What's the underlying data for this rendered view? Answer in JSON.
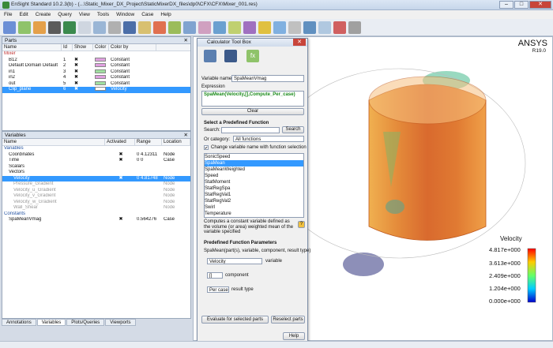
{
  "window": {
    "title": "EnSight Standard 10.2.3(b) - (...\\Static_Mixer_DX_Project\\StaticMixerDX_files\\dp0\\CFX\\CFX\\Mixer_001.res)"
  },
  "menu": [
    "File",
    "Edit",
    "Create",
    "Query",
    "View",
    "Tools",
    "Window",
    "Case",
    "Help"
  ],
  "parts": {
    "title": "Parts",
    "headers": [
      "Name",
      "Id",
      "Show",
      "Color",
      "Color by"
    ],
    "rows": [
      {
        "name": "Mixer",
        "id": "",
        "color": "",
        "colorby": ""
      },
      {
        "name": "B12",
        "id": "1",
        "color": "#e0a0e0",
        "colorby": "Constant"
      },
      {
        "name": "Default Domain Default",
        "id": "2",
        "color": "#e0a0e0",
        "colorby": "Constant"
      },
      {
        "name": "in1",
        "id": "3",
        "color": "#a0e0a0",
        "colorby": "Constant"
      },
      {
        "name": "in2",
        "id": "4",
        "color": "#e0a0e0",
        "colorby": "Constant"
      },
      {
        "name": "out",
        "id": "5",
        "color": "#a0e0a0",
        "colorby": "Constant"
      },
      {
        "name": "Clip_plane",
        "id": "6",
        "color": "#ffffff",
        "colorby": "Velocity"
      }
    ]
  },
  "variables": {
    "title": "Variables",
    "headers": [
      "Name",
      "Activated",
      "Range",
      "Location"
    ],
    "rows": [
      {
        "name": "Variables",
        "act": "",
        "range": "",
        "loc": ""
      },
      {
        "name": "Coordinates",
        "act": "✖",
        "range": "0  4.12311",
        "loc": "Node"
      },
      {
        "name": "Time",
        "act": "✖",
        "range": "0  0",
        "loc": "Case"
      },
      {
        "name": "Scalars",
        "act": "",
        "range": "",
        "loc": ""
      },
      {
        "name": "Vectors",
        "act": "",
        "range": "",
        "loc": ""
      },
      {
        "name": "Velocity",
        "act": "✖",
        "range": "0  4.81748",
        "loc": "Node"
      },
      {
        "name": "Pressure_Gradient",
        "act": "",
        "range": "",
        "loc": "Node"
      },
      {
        "name": "Velocity_u_Gradient",
        "act": "",
        "range": "",
        "loc": "Node"
      },
      {
        "name": "Velocity_v_Gradient",
        "act": "",
        "range": "",
        "loc": "Node"
      },
      {
        "name": "Velocity_w_Gradient",
        "act": "",
        "range": "",
        "loc": "Node"
      },
      {
        "name": "Wall_Shear",
        "act": "",
        "range": "",
        "loc": "Node"
      },
      {
        "name": "Constants",
        "act": "",
        "range": "",
        "loc": ""
      },
      {
        "name": "SpaMeanVmag",
        "act": "✖",
        "range": "0.564276",
        "loc": "Case"
      }
    ]
  },
  "bottom_tabs": [
    "Annotations",
    "Variables",
    "Plots/Queries",
    "Viewports"
  ],
  "calculator": {
    "title": "Calculator Tool Box",
    "var_name_label": "Variable name",
    "var_name": "SpaMeanVmag",
    "expression_label": "Expression",
    "expression": "SpaMean(Velocity,[],Compute_Per_case)",
    "clear": "Clear",
    "select_title": "Select a Predefined Function",
    "search_label": "Search:",
    "search_btn": "Search",
    "category_label": "Or category:",
    "category_value": "All functions",
    "change_label": "Change variable name with function selection",
    "functions": [
      "SonicSpeed",
      "SpaMean",
      "SpaMeanWeighted",
      "Speed",
      "StatMoment",
      "StatRegSpa",
      "StatRegVal1",
      "StatRegVal2",
      "Swirl",
      "Temperature"
    ],
    "selected_function": "SpaMean",
    "description": "Computes a constant variable defined as the volume (or area) weighted mean of the variable specified",
    "params_title": "Predefined Function Parameters",
    "signature": "SpaMean(part(s), variable, component, result type)",
    "param_var": "Velocity",
    "param_var_label": "variable",
    "param_comp": "[]",
    "param_comp_label": "component",
    "param_result": "Per case",
    "param_result_label": "result type",
    "eval_btn": "Evaluate for selected parts",
    "reselect_btn": "Reselect parts",
    "help_btn": "Help"
  },
  "viewer": {
    "brand": "ANSYS",
    "version": "R19.0",
    "legend_title": "Velocity",
    "legend_values": [
      "4.817e+000",
      "3.613e+000",
      "2.409e+000",
      "1.204e+000",
      "0.000e+000"
    ]
  }
}
